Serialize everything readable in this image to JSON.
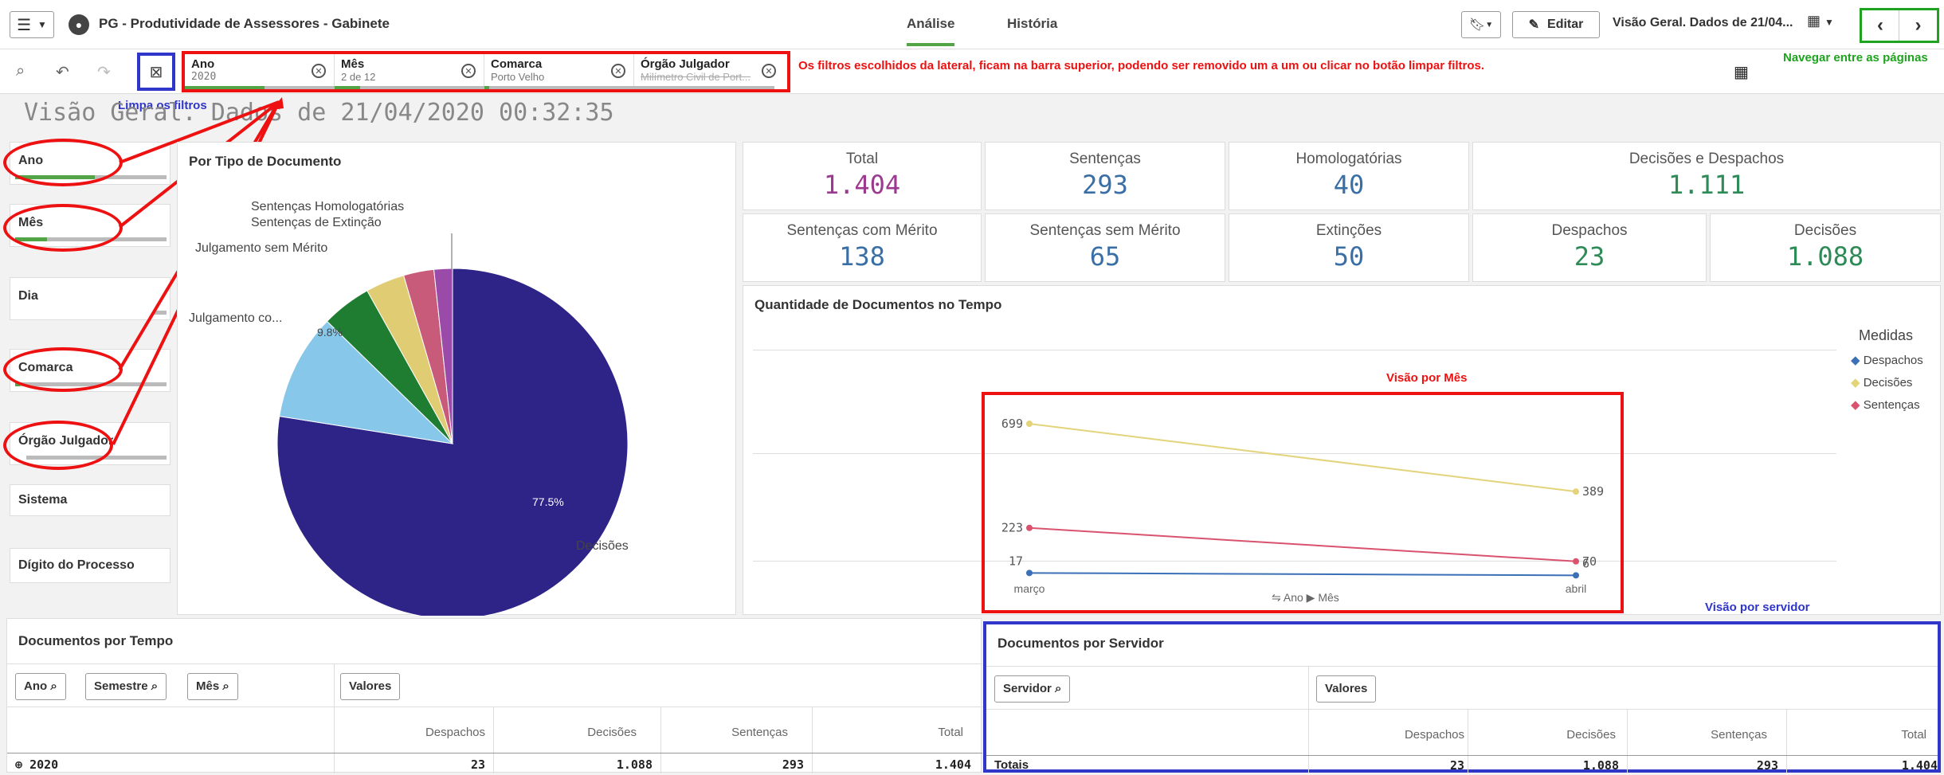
{
  "header": {
    "app_title": "PG - Produtividade de Assessores - Gabinete",
    "tabs": [
      "Análise",
      "História"
    ],
    "edit_label": "Editar",
    "sheet_name": "Visão Geral. Dados de 21/04..."
  },
  "filters": [
    {
      "title": "Ano",
      "value": "2020"
    },
    {
      "title": "Mês",
      "value": "2 de 12"
    },
    {
      "title": "Comarca",
      "value": "Porto Velho"
    },
    {
      "title": "Órgão Julgador",
      "value": "Milímetro Civil de Port..."
    }
  ],
  "annotations": {
    "filters_note": "Os filtros escolhidos da lateral,  ficam na barra superior, podendo ser removido um a um ou clicar no botão limpar filtros.",
    "clear_note": "Limpa os filtros",
    "nav_note": "Navegar entre as páginas",
    "month_view": "Visão por Mês",
    "server_view": "Visão por servidor"
  },
  "page_title": "Visão Geral. Dados de 21/04/2020 00:32:35",
  "filter_panel": [
    "Ano",
    "Mês",
    "Dia",
    "Comarca",
    "Órgão Julgador",
    "Sistema",
    "Dígito do Processo"
  ],
  "pie": {
    "title": "Por Tipo de Documento",
    "labels": [
      "Sentenças Homologatórias",
      "Sentenças de Extinção",
      "Julgamento sem Mérito",
      "Julgamento co...",
      "Decisões"
    ],
    "pct_big": "77.5%",
    "pct_small": "9.8%"
  },
  "kpis": [
    {
      "label": "Total",
      "value": "1.404",
      "color": "#9b3a8e"
    },
    {
      "label": "Sentenças",
      "value": "293",
      "color": "#3a6fa6"
    },
    {
      "label": "Homologatórias",
      "value": "40",
      "color": "#3a6fa6"
    },
    {
      "label": "Decisões e Despachos",
      "value": "1.111",
      "color": "#2e8b57"
    },
    {
      "label": "Sentenças com Mérito",
      "value": "138",
      "color": "#3a6fa6"
    },
    {
      "label": "Sentenças sem Mérito",
      "value": "65",
      "color": "#3a6fa6"
    },
    {
      "label": "Extinções",
      "value": "50",
      "color": "#3a6fa6"
    },
    {
      "label": "Despachos",
      "value": "23",
      "color": "#2e8b57"
    },
    {
      "label": "Decisões",
      "value": "1.088",
      "color": "#2e8b57"
    }
  ],
  "line_chart": {
    "title": "Quantidade de Documentos no Tempo",
    "legend_title": "Medidas",
    "dim_label": "Ano ▶ Mês"
  },
  "chart_data": {
    "type": "line",
    "x": [
      "março",
      "abril"
    ],
    "series": [
      {
        "name": "Despachos",
        "values": [
          17,
          6
        ],
        "color": "#3b6fb6"
      },
      {
        "name": "Decisões",
        "values": [
          699,
          389
        ],
        "color": "#e3d37a"
      },
      {
        "name": "Sentenças",
        "values": [
          223,
          70
        ],
        "color": "#d9536f"
      }
    ]
  },
  "pie_data": {
    "type": "pie",
    "slices": [
      {
        "label": "Decisões",
        "value": 77.5,
        "color": "#2e2387"
      },
      {
        "label": "Julgamento co...",
        "value": 9.8,
        "color": "#87c7ea"
      },
      {
        "label": "Julgamento sem Mérito",
        "value": 4.6,
        "color": "#1f7d32"
      },
      {
        "label": "Sentenças de Extinção",
        "value": 3.6,
        "color": "#e0cc72"
      },
      {
        "label": "Sentenças Homologatórias",
        "value": 2.8,
        "color": "#c85a7a"
      },
      {
        "label": "",
        "value": 1.7,
        "color": "#9a4aa8"
      }
    ]
  },
  "table_time": {
    "title": "Documentos por Tempo",
    "dims": [
      "Ano",
      "Semestre",
      "Mês"
    ],
    "values_label": "Valores",
    "cols": [
      "Despachos",
      "Decisões",
      "Sentenças",
      "Total"
    ],
    "row": {
      "label": "2020",
      "values": [
        "23",
        "1.088",
        "293",
        "1.404"
      ]
    }
  },
  "table_server": {
    "title": "Documentos por Servidor",
    "dim": "Servidor",
    "values_label": "Valores",
    "cols": [
      "Despachos",
      "Decisões",
      "Sentenças",
      "Total"
    ],
    "row": {
      "label": "Totais",
      "values": [
        "23",
        "1.088",
        "293",
        "1.404"
      ]
    }
  }
}
